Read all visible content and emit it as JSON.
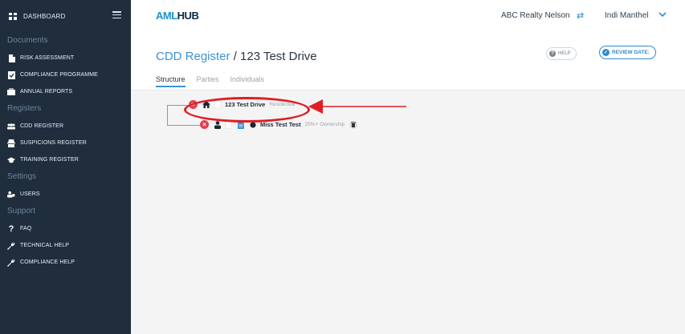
{
  "sidebar": {
    "dashboard": "DASHBOARD",
    "sections": {
      "documents": "Documents",
      "registers": "Registers",
      "settings": "Settings",
      "support": "Support"
    },
    "items": {
      "risk_assessment": "RISK ASSESSMENT",
      "compliance_programme": "COMPLIANCE PROGRAMME",
      "annual_reports": "ANNUAL REPORTS",
      "cdd_register": "CDD REGISTER",
      "suspicions_register": "SUSPICIONS REGISTER",
      "training_register": "TRAINING REGISTER",
      "users": "USERS",
      "faq": "FAQ",
      "technical_help": "TECHNICAL HELP",
      "compliance_help": "COMPLIANCE HELP"
    }
  },
  "header": {
    "logo_a": "AML",
    "logo_b": "HUB",
    "org": "ABC Realty Nelson",
    "user": "Indi Manthel"
  },
  "page": {
    "title_link": "CDD Register",
    "title_rest": " / 123 Test Drive",
    "help": "HELP",
    "review_date": "REVIEW DATE:",
    "tabs": [
      "Structure",
      "Parties",
      "Individuals"
    ]
  },
  "tree": {
    "property": {
      "name": "123 Test Drive",
      "type": "Residential"
    },
    "party": {
      "name": "Miss Test Test",
      "detail": "25%+ Ownership"
    }
  },
  "colors": {
    "sidebar_bg": "#1f2d3d",
    "accent": "#3b93d6",
    "remove": "#e23f52",
    "annotation": "#e01e24"
  }
}
